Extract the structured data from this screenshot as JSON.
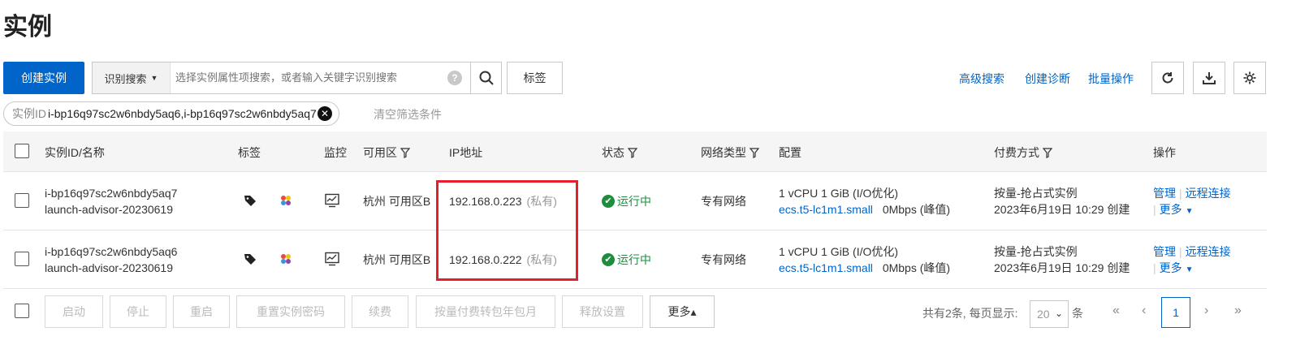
{
  "page": {
    "title": "实例"
  },
  "toolbar": {
    "create_label": "创建实例",
    "search_mode": "识别搜索",
    "search_placeholder": "选择实例属性项搜索，或者输入关键字识别搜索",
    "help_glyph": "?",
    "tag_label": "标签",
    "links": {
      "advanced": "高级搜索",
      "diagnose": "创建诊断",
      "batch": "批量操作"
    }
  },
  "filter": {
    "key": "实例ID",
    "value": "i-bp16q97sc2w6nbdy5aq6,i-bp16q97sc2w6nbdy5aq7",
    "clear_label": "清空筛选条件"
  },
  "table": {
    "columns": [
      "实例ID/名称",
      "标签",
      "监控",
      "可用区",
      "IP地址",
      "状态",
      "网络类型",
      "配置",
      "付费方式",
      "操作"
    ],
    "rows": [
      {
        "id": "i-bp16q97sc2w6nbdy5aq7",
        "name": "launch-advisor-20230619",
        "zone": "杭州 可用区B",
        "ip": "192.168.0.223",
        "ip_type": "(私有)",
        "status": "运行中",
        "network": "专有网络",
        "config_line1": "1 vCPU 1 GiB   (I/O优化)",
        "instance_type": "ecs.t5-lc1m1.small",
        "bandwidth": "0Mbps   (峰值)",
        "billing": "按量-抢占式实例",
        "created": "2023年6月19日 10:29 创建",
        "actions": {
          "manage": "管理",
          "remote": "远程连接",
          "more": "更多"
        }
      },
      {
        "id": "i-bp16q97sc2w6nbdy5aq6",
        "name": "launch-advisor-20230619",
        "zone": "杭州 可用区B",
        "ip": "192.168.0.222",
        "ip_type": "(私有)",
        "status": "运行中",
        "network": "专有网络",
        "config_line1": "1 vCPU 1 GiB   (I/O优化)",
        "instance_type": "ecs.t5-lc1m1.small",
        "bandwidth": "0Mbps   (峰值)",
        "billing": "按量-抢占式实例",
        "created": "2023年6月19日 10:29 创建",
        "actions": {
          "manage": "管理",
          "remote": "远程连接",
          "more": "更多"
        }
      }
    ]
  },
  "bottom": {
    "buttons": [
      "启动",
      "停止",
      "重启",
      "重置实例密码",
      "续费",
      "按量付费转包年包月",
      "释放设置"
    ],
    "more_label": "更多▴",
    "total_text": "共有2条, 每页显示:",
    "page_size": "20",
    "unit": "条",
    "current_page": "1"
  },
  "colors": {
    "primary": "#0064c8",
    "running": "#1e8e3e",
    "highlight": "#e3202b"
  }
}
